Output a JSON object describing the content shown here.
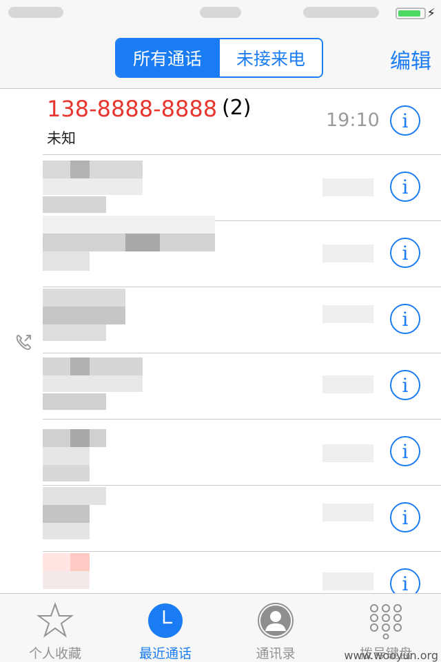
{
  "colors": {
    "accent": "#1a7cf2",
    "missed": "#e8362f"
  },
  "nav": {
    "segment_all": "所有通话",
    "segment_missed": "未接来电",
    "edit_label": "编辑"
  },
  "calls": [
    {
      "number": "138-8888-8888",
      "count": "(2)",
      "subtitle": "未知",
      "time": "19:10"
    }
  ],
  "tabs": [
    {
      "label": "个人收藏",
      "icon": "star-icon"
    },
    {
      "label": "最近通话",
      "icon": "clock-icon"
    },
    {
      "label": "通讯录",
      "icon": "contact-icon"
    },
    {
      "label": "拨号键盘",
      "icon": "keypad-icon"
    }
  ],
  "watermark": "www.wooyun.org"
}
